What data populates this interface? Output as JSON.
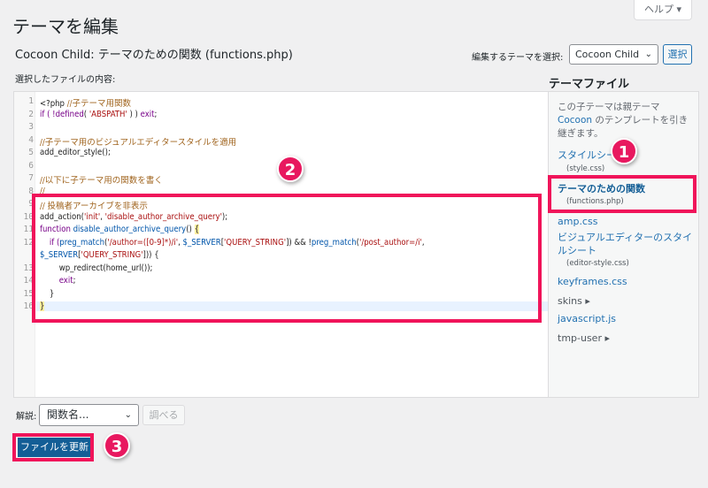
{
  "header": {
    "help_label": "ヘルプ ▾",
    "title": "テーマを編集",
    "subtitle": "Cocoon Child: テーマのための関数 (functions.php)",
    "theme_select_label": "編集するテーマを選択:",
    "theme_selected": "Cocoon Child",
    "select_button": "選択",
    "content_label": "選択したファイルの内容:"
  },
  "editor": {
    "line_numbers": [
      "1",
      "2",
      "3",
      "4",
      "5",
      "6",
      "7",
      "8",
      "9",
      "10",
      "11",
      "12",
      "",
      "13",
      "14",
      "15",
      "16"
    ],
    "lines": [
      [
        [
          "<?php ",
          "p"
        ],
        [
          "//子テーマ用関数",
          "c"
        ]
      ],
      [
        [
          "if ( !",
          "k"
        ],
        [
          "defined",
          "k"
        ],
        [
          "( ",
          "p"
        ],
        [
          "'ABSPATH'",
          "s"
        ],
        [
          " ) ) ",
          "p"
        ],
        [
          "exit",
          "k"
        ],
        [
          ";",
          "p"
        ]
      ],
      [],
      [
        [
          "//子テーマ用のビジュアルエディタースタイルを適用",
          "c"
        ]
      ],
      [
        [
          "add_editor_style();",
          "p"
        ]
      ],
      [],
      [
        [
          "//以下に子テーマ用の関数を書く",
          "c"
        ]
      ],
      [
        [
          "//",
          "c"
        ]
      ],
      [
        [
          "// 投稿者アーカイブを非表示",
          "c"
        ]
      ],
      [
        [
          "add_action(",
          "p"
        ],
        [
          "'init'",
          "s"
        ],
        [
          ", ",
          "p"
        ],
        [
          "'disable_author_archive_query'",
          "s"
        ],
        [
          ");",
          "p"
        ]
      ],
      [
        [
          "function ",
          "k"
        ],
        [
          "disable_author_archive_query",
          "v"
        ],
        [
          "() ",
          "p"
        ],
        [
          "{",
          "b"
        ]
      ],
      [
        [
          "    if (",
          "k"
        ],
        [
          "preg_match",
          "v"
        ],
        [
          "(",
          "p"
        ],
        [
          "'/author=([0-9]*)/i'",
          "s"
        ],
        [
          ", ",
          "p"
        ],
        [
          "$_SERVER",
          "v"
        ],
        [
          "[",
          "p"
        ],
        [
          "'QUERY_STRING'",
          "s"
        ],
        [
          "]) && !",
          "p"
        ],
        [
          "preg_match",
          "v"
        ],
        [
          "(",
          "p"
        ],
        [
          "'/post_author=/i'",
          "s"
        ],
        [
          ",",
          "p"
        ]
      ],
      [
        [
          "$_SERVER",
          "v"
        ],
        [
          "[",
          "p"
        ],
        [
          "'QUERY_STRING'",
          "s"
        ],
        [
          "])) {",
          "p"
        ]
      ],
      [
        [
          "        wp_redirect(home_url());",
          "p"
        ]
      ],
      [
        [
          "        exit",
          "k"
        ],
        [
          ";",
          "p"
        ]
      ],
      [
        [
          "    }",
          "p"
        ]
      ],
      [
        [
          "}",
          "b"
        ]
      ]
    ]
  },
  "sidebar": {
    "title": "テーマファイル",
    "desc_before": "この子テーマは親テーマ ",
    "desc_link": "Cocoon",
    "desc_after": " のテンプレートを引き継ぎます。",
    "items": [
      {
        "label": "スタイルシート",
        "file": "(style.css)"
      },
      {
        "label": "テーマのための関数",
        "file": "(functions.php)"
      },
      {
        "label": "amp.css"
      },
      {
        "label": "ビジュアルエディターのスタイルシート",
        "file": "(editor-style.css)"
      },
      {
        "label": "keyframes.css"
      },
      {
        "label": "skins ▸"
      },
      {
        "label": "javascript.js"
      },
      {
        "label": "tmp-user ▸"
      }
    ]
  },
  "footer": {
    "doc_label": "解説:",
    "doc_select": "関数名...",
    "lookup_button": "調べる",
    "update_button": "ファイルを更新"
  },
  "annotations": {
    "badge1": "1",
    "badge2": "2",
    "badge3": "3",
    "highlight_color": "#f0145a"
  }
}
